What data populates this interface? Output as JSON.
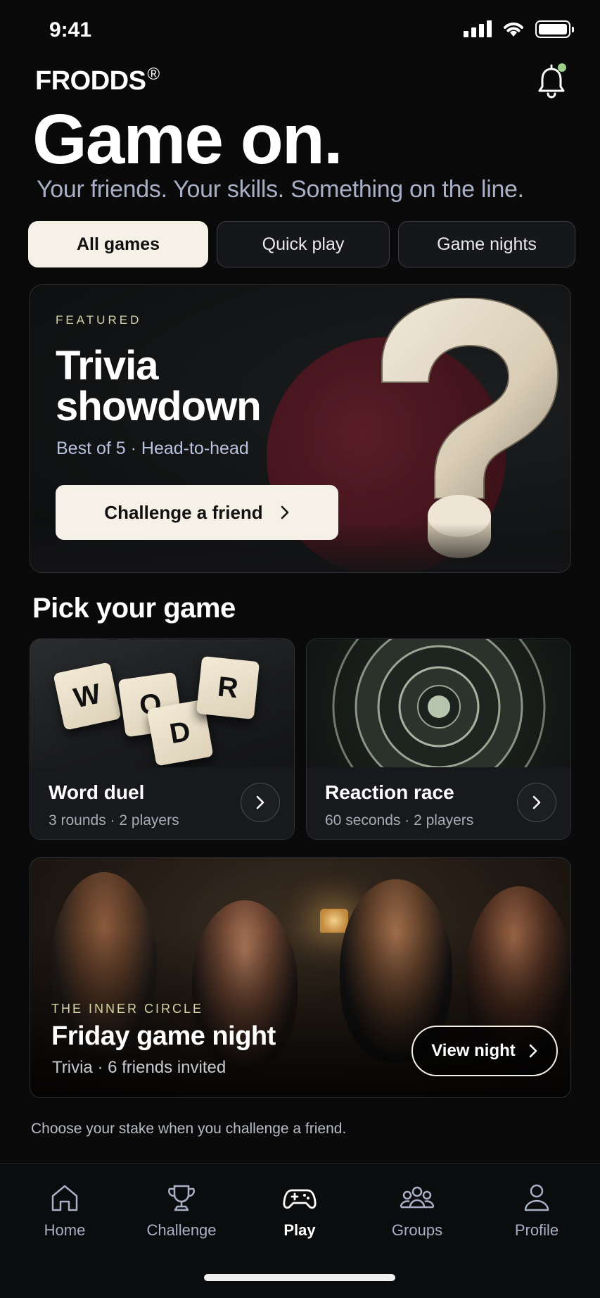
{
  "status_bar": {
    "time": "9:41"
  },
  "header": {
    "brand": "FRODDS",
    "brand_mark": "®",
    "title": "Game on.",
    "subtitle": "Your friends. Your skills. Something on the line."
  },
  "tabs": [
    {
      "label": "All games",
      "active": true
    },
    {
      "label": "Quick play",
      "active": false
    },
    {
      "label": "Game nights",
      "active": false
    }
  ],
  "featured": {
    "kicker": "FEATURED",
    "title": "Trivia showdown",
    "meta": "Best of 5  ·  Head-to-head",
    "button_label": "Challenge a friend"
  },
  "section": {
    "title": "Pick your game"
  },
  "games": [
    {
      "name": "Word duel",
      "meta": "3 rounds  ·  2 players",
      "tiles": [
        "W",
        "O",
        "D",
        "R"
      ]
    },
    {
      "name": "Reaction race",
      "meta": "60 seconds  ·  2 players"
    }
  ],
  "game_night": {
    "kicker": "THE INNER CIRCLE",
    "title": "Friday game night",
    "meta": "Trivia  ·  6 friends invited",
    "button_label": "View night"
  },
  "footnote": "Choose your stake when you challenge a friend.",
  "bottom_nav": [
    {
      "label": "Home",
      "icon": "home-icon",
      "active": false
    },
    {
      "label": "Challenge",
      "icon": "trophy-icon",
      "active": false
    },
    {
      "label": "Play",
      "icon": "gamepad-icon",
      "active": true
    },
    {
      "label": "Groups",
      "icon": "groups-icon",
      "active": false
    },
    {
      "label": "Profile",
      "icon": "profile-icon",
      "active": false
    }
  ],
  "colors": {
    "background": "#0a0a0a",
    "accent_cream": "#f5f1e7",
    "notification_dot": "#9ed28a",
    "kicker": "#d6d6a8"
  }
}
